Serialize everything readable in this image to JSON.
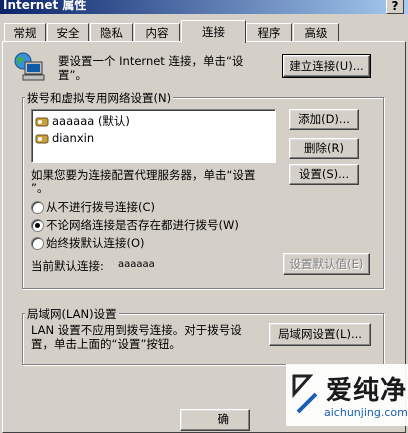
{
  "window": {
    "title": "Internet 属性",
    "help": "?"
  },
  "tabs": [
    {
      "label": "常规"
    },
    {
      "label": "安全"
    },
    {
      "label": "隐私"
    },
    {
      "label": "内容"
    },
    {
      "label": "连接",
      "active": true
    },
    {
      "label": "程序"
    },
    {
      "label": "高级"
    }
  ],
  "setup": {
    "text_line1": "要设置一个 Internet 连接，单击“设",
    "text_line2": "置”。",
    "button": "建立连接(U)..."
  },
  "dialup": {
    "legend": "拨号和虚拟专用网络设置(N)",
    "connections": [
      {
        "name": "aaaaaa (默认)"
      },
      {
        "name": "dianxin"
      }
    ],
    "add_button": "添加(D)...",
    "remove_button": "删除(R)",
    "proxy_text_line1": "如果您要为连接配置代理服务器，单击“设置",
    "proxy_text_line2": "”。",
    "settings_button": "设置(S)...",
    "options": [
      {
        "label": "从不进行拨号连接(C)",
        "selected": false
      },
      {
        "label": "不论网络连接是否存在都进行拨号(W)",
        "selected": true
      },
      {
        "label": "始终拨默认连接(O)",
        "selected": false
      }
    ],
    "current_default_label": "当前默认连接:",
    "current_default_value": "aaaaaa",
    "set_default_button": "设置默认值(E)"
  },
  "lan": {
    "legend": "局域网(LAN)设置",
    "text_line1": "LAN 设置不应用到拨号连接。对于拨号设",
    "text_line2": "置，单击上面的“设置”按钮。",
    "button": "局域网设置(L)..."
  },
  "bottom": {
    "partial_button": "确"
  },
  "watermark": {
    "brand": "爱纯净",
    "url": "aichunjing.com"
  },
  "colors": {
    "titlebar": "#0a246a",
    "face": "#d4d0c8",
    "watermark_blue": "#1a5fb4"
  }
}
